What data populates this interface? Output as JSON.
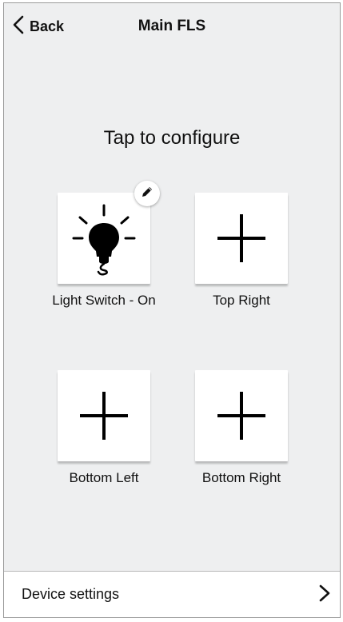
{
  "header": {
    "back_label": "Back",
    "title": "Main FLS"
  },
  "instruction": "Tap to configure",
  "tiles": [
    {
      "label": "Light Switch - On",
      "icon": "lightbulb-icon",
      "configured": true
    },
    {
      "label": "Top Right",
      "icon": "plus-icon",
      "configured": false
    },
    {
      "label": "Bottom Left",
      "icon": "plus-icon",
      "configured": false
    },
    {
      "label": "Bottom Right",
      "icon": "plus-icon",
      "configured": false
    }
  ],
  "footer": {
    "label": "Device settings",
    "icon": "chevron-right-icon"
  },
  "colors": {
    "background": "#eeeff0",
    "tile": "#ffffff",
    "text": "#111111"
  }
}
